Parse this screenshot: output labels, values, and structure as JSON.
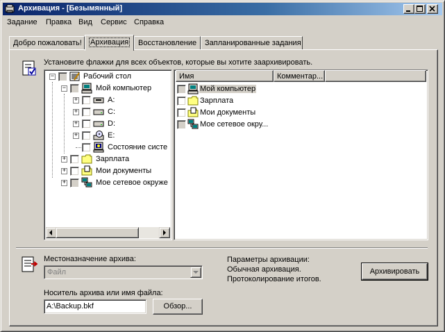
{
  "window": {
    "title": "Архивация - [Безымянный]"
  },
  "menu": {
    "items": [
      {
        "label": "Задание"
      },
      {
        "label": "Правка"
      },
      {
        "label": "Вид"
      },
      {
        "label": "Сервис"
      },
      {
        "label": "Справка"
      }
    ]
  },
  "tabs": [
    {
      "label": "Добро пожаловать!"
    },
    {
      "label": "Архивация"
    },
    {
      "label": "Восстановление"
    },
    {
      "label": "Запланированные задания"
    }
  ],
  "instructions": "Установите флажки для всех объектов, которые вы хотите заархивировать.",
  "tree": {
    "items": [
      {
        "label": "Рабочий стол",
        "expander": "−",
        "checked": "grey",
        "icon": "desktop-icon"
      },
      {
        "label": "Мой компьютер",
        "expander": "−",
        "checked": "grey",
        "icon": "computer-icon"
      },
      {
        "label": "A:",
        "expander": "+",
        "checked": "empty",
        "icon": "floppy-drive-icon"
      },
      {
        "label": "C:",
        "expander": "+",
        "checked": "empty",
        "icon": "hard-drive-icon"
      },
      {
        "label": "D:",
        "expander": "+",
        "checked": "empty",
        "icon": "hard-drive-icon"
      },
      {
        "label": "E:",
        "expander": "+",
        "checked": "empty",
        "icon": "cd-drive-icon"
      },
      {
        "label": "Состояние систе",
        "expander": "",
        "checked": "empty",
        "icon": "system-state-icon"
      },
      {
        "label": "Зарплата",
        "expander": "+",
        "checked": "empty",
        "icon": "folder-icon"
      },
      {
        "label": "Мои документы",
        "expander": "+",
        "checked": "empty",
        "icon": "my-documents-icon"
      },
      {
        "label": "Мое сетевое окруже",
        "expander": "+",
        "checked": "grey",
        "icon": "network-icon"
      }
    ]
  },
  "list": {
    "columns": [
      "Имя",
      "Комментар..."
    ],
    "items": [
      {
        "label": "Мой компьютер",
        "checked": "grey",
        "icon": "computer-icon"
      },
      {
        "label": "Зарплата",
        "checked": "empty",
        "icon": "folder-icon"
      },
      {
        "label": "Мои документы",
        "checked": "empty",
        "icon": "my-documents-icon"
      },
      {
        "label": "Мое сетевое окру...",
        "checked": "grey",
        "icon": "network-icon"
      }
    ]
  },
  "destination": {
    "label": "Местоназначение архива:",
    "value": "Файл"
  },
  "media": {
    "label": "Носитель архива или имя файла:",
    "value": "A:\\Backup.bkf"
  },
  "browse_button": "Обзор...",
  "params": {
    "title": "Параметры архивации:",
    "line1": "Обычная архивация.",
    "line2": "Протоколирование итогов."
  },
  "archive_button": "Архивировать",
  "colors": {
    "title_start": "#0a246a",
    "title_end": "#a6caf0",
    "face": "#d4d0c8"
  }
}
